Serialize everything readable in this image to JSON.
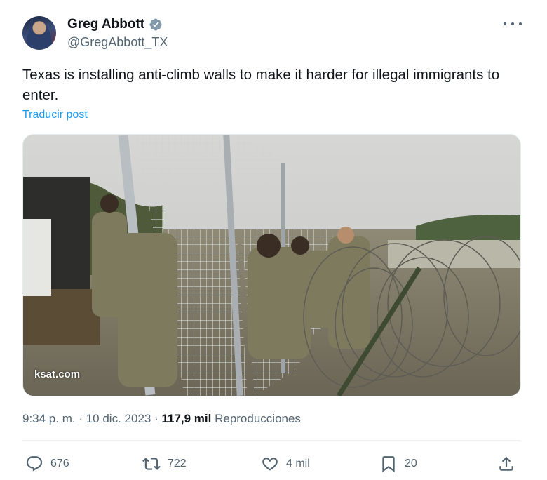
{
  "author": {
    "name": "Greg Abbott",
    "handle": "@GregAbbott_TX",
    "verified": true,
    "avatar_icon": "avatar-photo"
  },
  "post": {
    "text": "Texas is installing anti-climb walls to make it harder for illegal immigrants to enter.",
    "translate_label": "Traducir post",
    "media_watermark": "ksat.com"
  },
  "meta": {
    "time": "9:34 p. m.",
    "sep1": " · ",
    "date": "10 dic. 2023",
    "sep2": " · ",
    "views": "117,9 mil",
    "views_label": " Reproducciones"
  },
  "actions": {
    "replies": "676",
    "reposts": "722",
    "likes": "4 mil",
    "bookmarks": "20"
  },
  "colors": {
    "link": "#1d9bf0",
    "secondary_text": "#536471",
    "verified_badge": "#829aab"
  }
}
